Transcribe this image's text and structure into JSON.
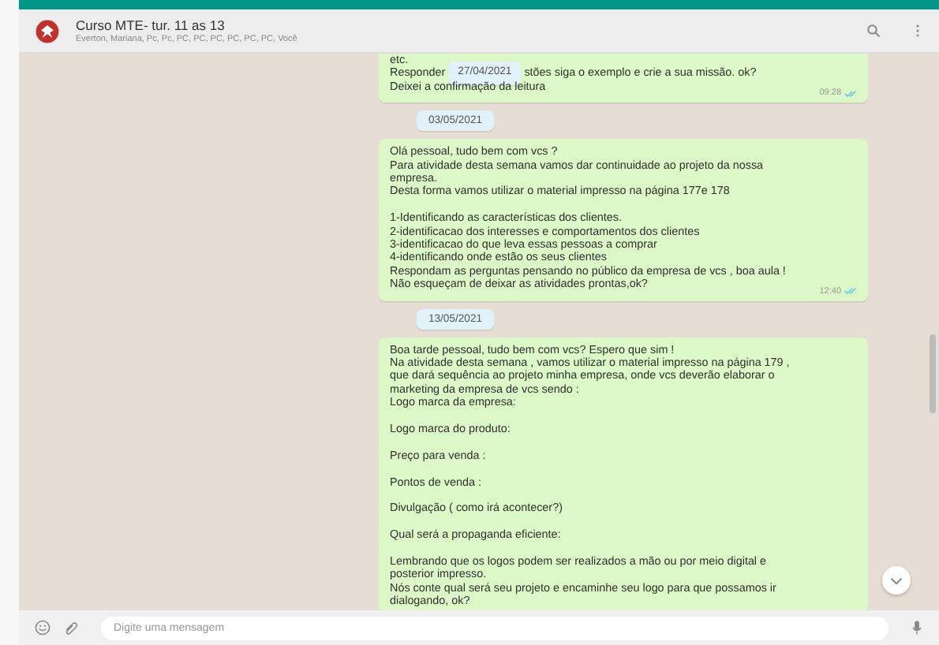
{
  "header": {
    "title": "Curso MTE- tur. 11 as 13",
    "participants": "Everton, Mariana, Pc, Pc, PC, PC, PC, PC, PC, PC, Você"
  },
  "messages": [
    {
      "kind": "message",
      "time": "09:28",
      "read": true,
      "paragraphs": [
        [
          {
            "text": "etc."
          },
          {
            "text": "Responder",
            "overlay_date": "27/04/2021",
            "text_after": "stões siga o exemplo e crie a sua missão. ok?"
          },
          {
            "text": "Deixei a confirmação da leitura"
          }
        ]
      ]
    },
    {
      "kind": "date",
      "text": "03/05/2021"
    },
    {
      "kind": "message",
      "time": "12:40",
      "read": true,
      "paragraphs": [
        [
          {
            "text": "Olá pessoal, tudo bem com vcs ?"
          },
          {
            "text": "Para atividade desta semana vamos dar continuidade ao projeto da nossa"
          },
          {
            "text": "empresa."
          },
          {
            "text": "Desta forma vamos utilizar o material impresso na página 177e 178"
          }
        ],
        [
          {
            "text": " 1-Identificando as características dos clientes."
          },
          {
            "text": "2-identificacao dos interesses e comportamentos dos clientes"
          },
          {
            "text": "3-identificacao do que leva essas pessoas a comprar"
          },
          {
            "text": "4-identificando onde estão os seus clientes"
          },
          {
            "text": "Respondam as perguntas pensando no público da empresa de vcs , boa aula !"
          },
          {
            "text": "Não esqueçam de deixar as atividades prontas,ok?"
          }
        ]
      ]
    },
    {
      "kind": "date",
      "text": "13/05/2021"
    },
    {
      "kind": "message",
      "paragraphs": [
        [
          {
            "text": "Boa tarde pessoal, tudo bem com vcs? Espero que sim !"
          },
          {
            "text": "Na atividade desta semana , vamos utilizar o material impresso na página 179 ,"
          },
          {
            "text": "que dará sequência ao projeto minha empresa, onde vcs deverão elaborar o"
          },
          {
            "text": "marketing da empresa de vcs sendo :"
          },
          {
            "text": "Logo marca da empresa:"
          }
        ],
        [
          {
            "text": "Logo marca do produto:"
          }
        ],
        [
          {
            "text": "Preço para venda :"
          }
        ],
        [
          {
            "text": "Pontos de venda :"
          }
        ],
        [
          {
            "text": "Divulgação ( como irá acontecer?)"
          }
        ],
        [
          {
            "text": "Qual será a propaganda eficiente:"
          }
        ],
        [
          {
            "text": "Lembrando que os logos podem ser realizados a mão ou por meio digital e"
          },
          {
            "text": "posterior impresso."
          },
          {
            "text": "Nós conte qual será seu projeto e encaminhe seu logo para que possamos ir"
          },
          {
            "text": "dialogando, ok?"
          }
        ]
      ]
    }
  ],
  "composer": {
    "placeholder": "Digite uma mensagem"
  }
}
